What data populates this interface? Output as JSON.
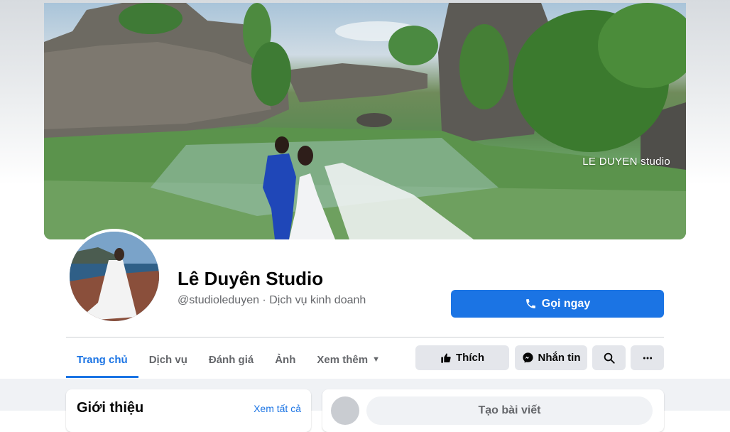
{
  "cover": {
    "watermark": "LE DUYEN studio"
  },
  "profile": {
    "name": "Lê Duyên Studio",
    "handle": "@studioleduyen · Dịch vụ kinh doanh"
  },
  "call_button": {
    "label": "Gọi ngay",
    "icon": "phone-icon"
  },
  "tabs": [
    {
      "label": "Trang chủ",
      "active": true
    },
    {
      "label": "Dịch vụ"
    },
    {
      "label": "Đánh giá"
    },
    {
      "label": "Ảnh"
    },
    {
      "label": "Xem thêm",
      "icon": "caret-down-icon"
    }
  ],
  "actions": {
    "like_label": "Thích",
    "message_label": "Nhắn tin",
    "search_icon": "search-icon",
    "more_icon": "more-icon"
  },
  "intro": {
    "title": "Giới thiệu",
    "see_all": "Xem tất cả"
  },
  "composer": {
    "label": "Tạo bài viết"
  },
  "colors": {
    "accent": "#1b74e4",
    "button_gray": "#e4e6eb",
    "feed_bg": "#f0f2f5"
  }
}
